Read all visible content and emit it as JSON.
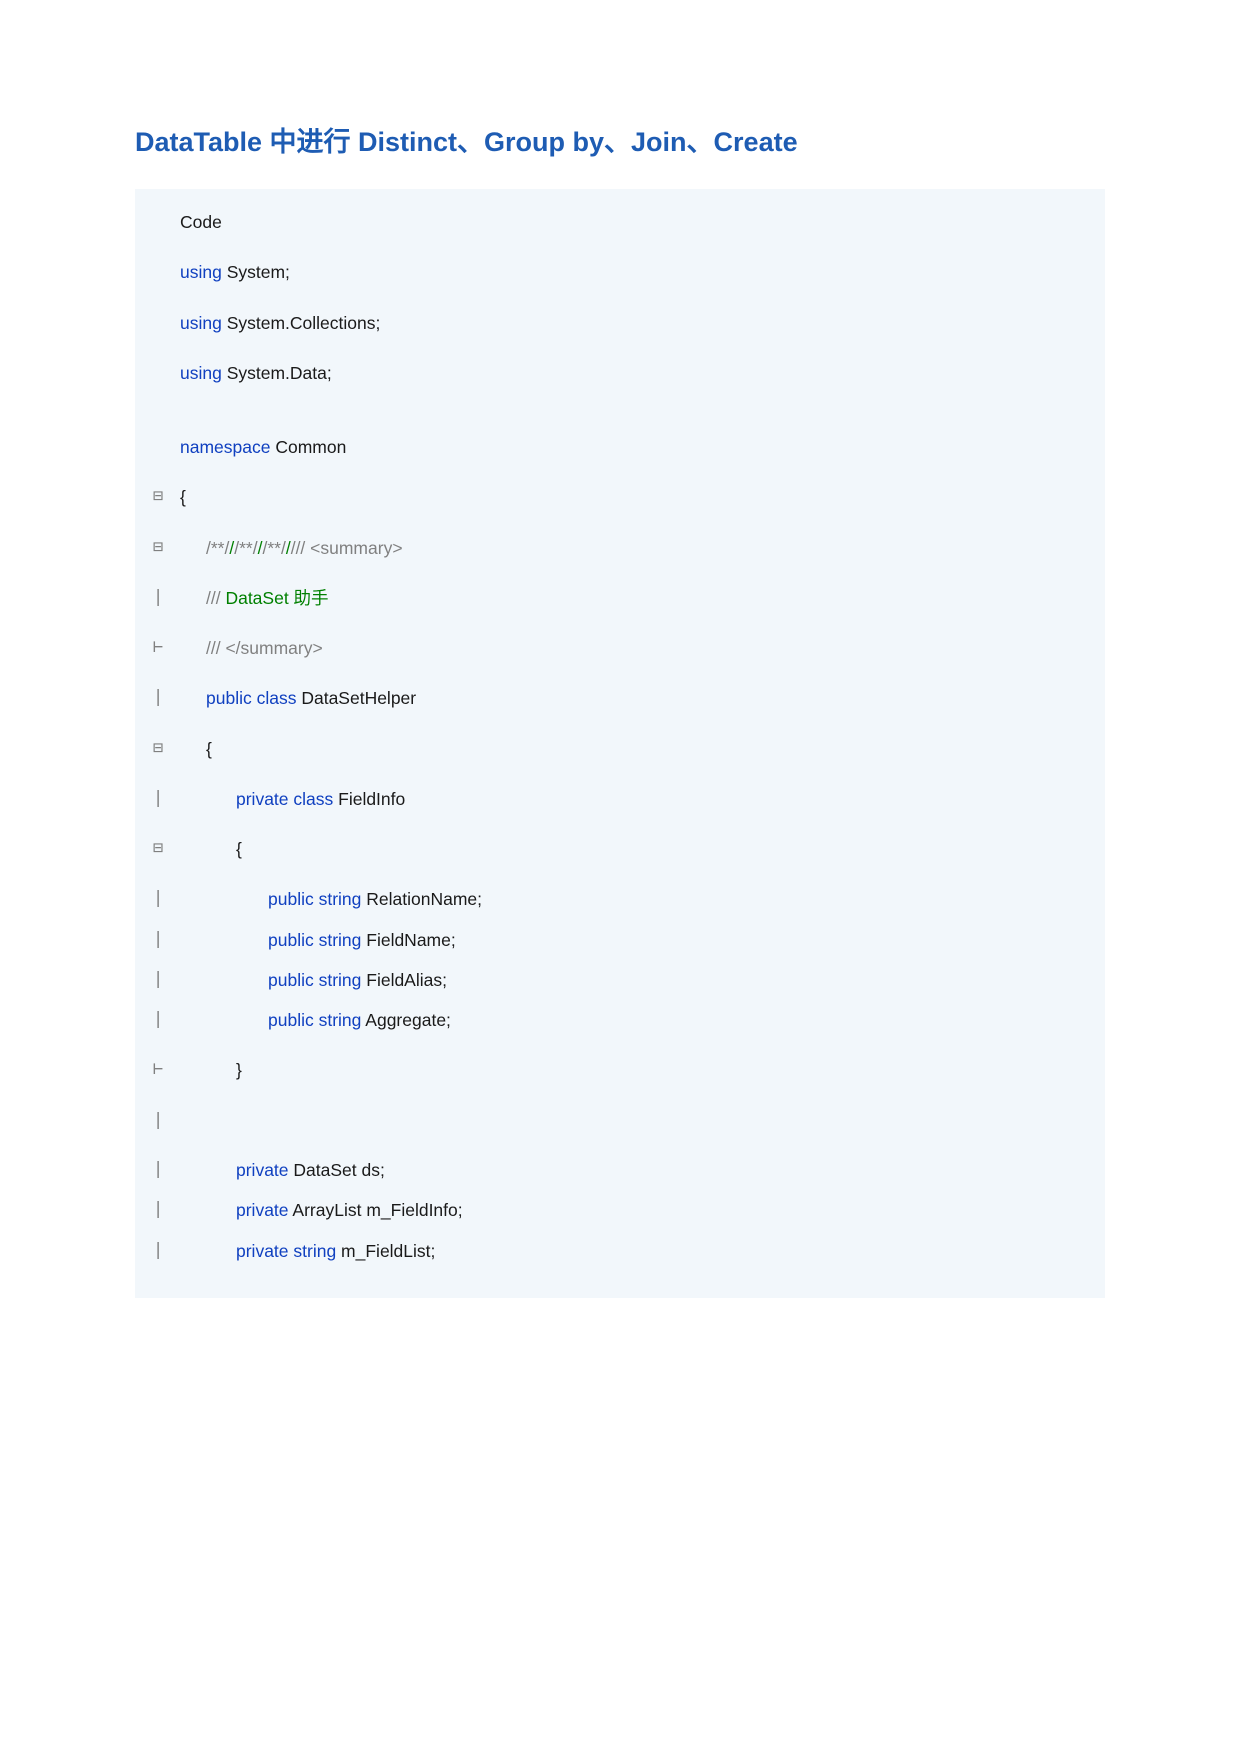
{
  "title": "DataTable 中进行 Distinct、Group by、Join、Create",
  "lines": [
    {
      "gutter": "",
      "class": "",
      "tokens": [
        {
          "t": "txt",
          "v": "Code"
        }
      ],
      "spacer": "small"
    },
    {
      "gutter": "",
      "class": "",
      "tokens": [
        {
          "t": "kw",
          "v": "using"
        },
        {
          "t": "txt",
          "v": " System;"
        }
      ],
      "spacer": "small"
    },
    {
      "gutter": "",
      "class": "",
      "tokens": [
        {
          "t": "kw",
          "v": "using"
        },
        {
          "t": "txt",
          "v": " System.Collections;"
        }
      ],
      "spacer": "small"
    },
    {
      "gutter": "",
      "class": "",
      "tokens": [
        {
          "t": "kw",
          "v": "using"
        },
        {
          "t": "txt",
          "v": " System.Data;"
        }
      ],
      "spacer": "large"
    },
    {
      "gutter": "",
      "class": "",
      "tokens": [
        {
          "t": "kw",
          "v": "namespace"
        },
        {
          "t": "txt",
          "v": " Common"
        }
      ],
      "spacer": "small"
    },
    {
      "gutter": "⊟",
      "class": "",
      "tokens": [
        {
          "t": "txt",
          "v": "{"
        }
      ],
      "spacer": "small"
    },
    {
      "gutter": "⊟",
      "class": "indent1",
      "tokens": [
        {
          "t": "com",
          "v": "/**/"
        },
        {
          "t": "green-com",
          "v": "/"
        },
        {
          "t": "com",
          "v": "/**/"
        },
        {
          "t": "green-com",
          "v": "/"
        },
        {
          "t": "com",
          "v": "/**/"
        },
        {
          "t": "green-com",
          "v": "/"
        },
        {
          "t": "com",
          "v": "/// "
        },
        {
          "t": "com",
          "v": "<summary>"
        }
      ],
      "spacer": "small"
    },
    {
      "gutter": "|",
      "class": "indent1",
      "tokens": [
        {
          "t": "com",
          "v": "/// "
        },
        {
          "t": "green-com",
          "v": "DataSet 助手"
        }
      ],
      "spacer": "small"
    },
    {
      "gutter": "⊢",
      "class": "indent1",
      "tokens": [
        {
          "t": "com",
          "v": "/// </summary>"
        }
      ],
      "spacer": "small"
    },
    {
      "gutter": "|",
      "class": "indent1",
      "tokens": [
        {
          "t": "kw",
          "v": "public class"
        },
        {
          "t": "txt",
          "v": " DataSetHelper"
        }
      ],
      "spacer": "small"
    },
    {
      "gutter": "⊟",
      "class": "indent1",
      "tokens": [
        {
          "t": "txt",
          "v": "{"
        }
      ],
      "spacer": "small"
    },
    {
      "gutter": "|",
      "class": "indent2",
      "tokens": [
        {
          "t": "kw",
          "v": "private class"
        },
        {
          "t": "txt",
          "v": " FieldInfo"
        }
      ],
      "spacer": "small"
    },
    {
      "gutter": "⊟",
      "class": "indent2",
      "tokens": [
        {
          "t": "txt",
          "v": "{"
        }
      ],
      "spacer": "small"
    },
    {
      "gutter": "|",
      "class": "indent3",
      "tokens": [
        {
          "t": "kw",
          "v": "public string"
        },
        {
          "t": "txt",
          "v": " RelationName;"
        }
      ],
      "spacer": "none"
    },
    {
      "gutter": "|",
      "class": "indent3",
      "tokens": [
        {
          "t": "kw",
          "v": "public string"
        },
        {
          "t": "txt",
          "v": " FieldName;"
        }
      ],
      "spacer": "none"
    },
    {
      "gutter": "|",
      "class": "indent3",
      "tokens": [
        {
          "t": "kw",
          "v": "public string"
        },
        {
          "t": "txt",
          "v": " FieldAlias;"
        }
      ],
      "spacer": "none"
    },
    {
      "gutter": "|",
      "class": "indent3",
      "tokens": [
        {
          "t": "kw",
          "v": "public string"
        },
        {
          "t": "txt",
          "v": " Aggregate;"
        }
      ],
      "spacer": "small"
    },
    {
      "gutter": "⊢",
      "class": "indent2",
      "tokens": [
        {
          "t": "txt",
          "v": "}"
        }
      ],
      "spacer": "small"
    },
    {
      "gutter": "|",
      "class": "",
      "tokens": [],
      "spacer": "small"
    },
    {
      "gutter": "|",
      "class": "indent2",
      "tokens": [
        {
          "t": "kw",
          "v": "private"
        },
        {
          "t": "txt",
          "v": " DataSet ds;"
        }
      ],
      "spacer": "none"
    },
    {
      "gutter": "|",
      "class": "indent2",
      "tokens": [
        {
          "t": "kw",
          "v": "private"
        },
        {
          "t": "txt",
          "v": " ArrayList m_FieldInfo;"
        }
      ],
      "spacer": "none"
    },
    {
      "gutter": "|",
      "class": "indent2",
      "tokens": [
        {
          "t": "kw",
          "v": "private string"
        },
        {
          "t": "txt",
          "v": " m_FieldList;"
        }
      ],
      "spacer": "none"
    }
  ]
}
